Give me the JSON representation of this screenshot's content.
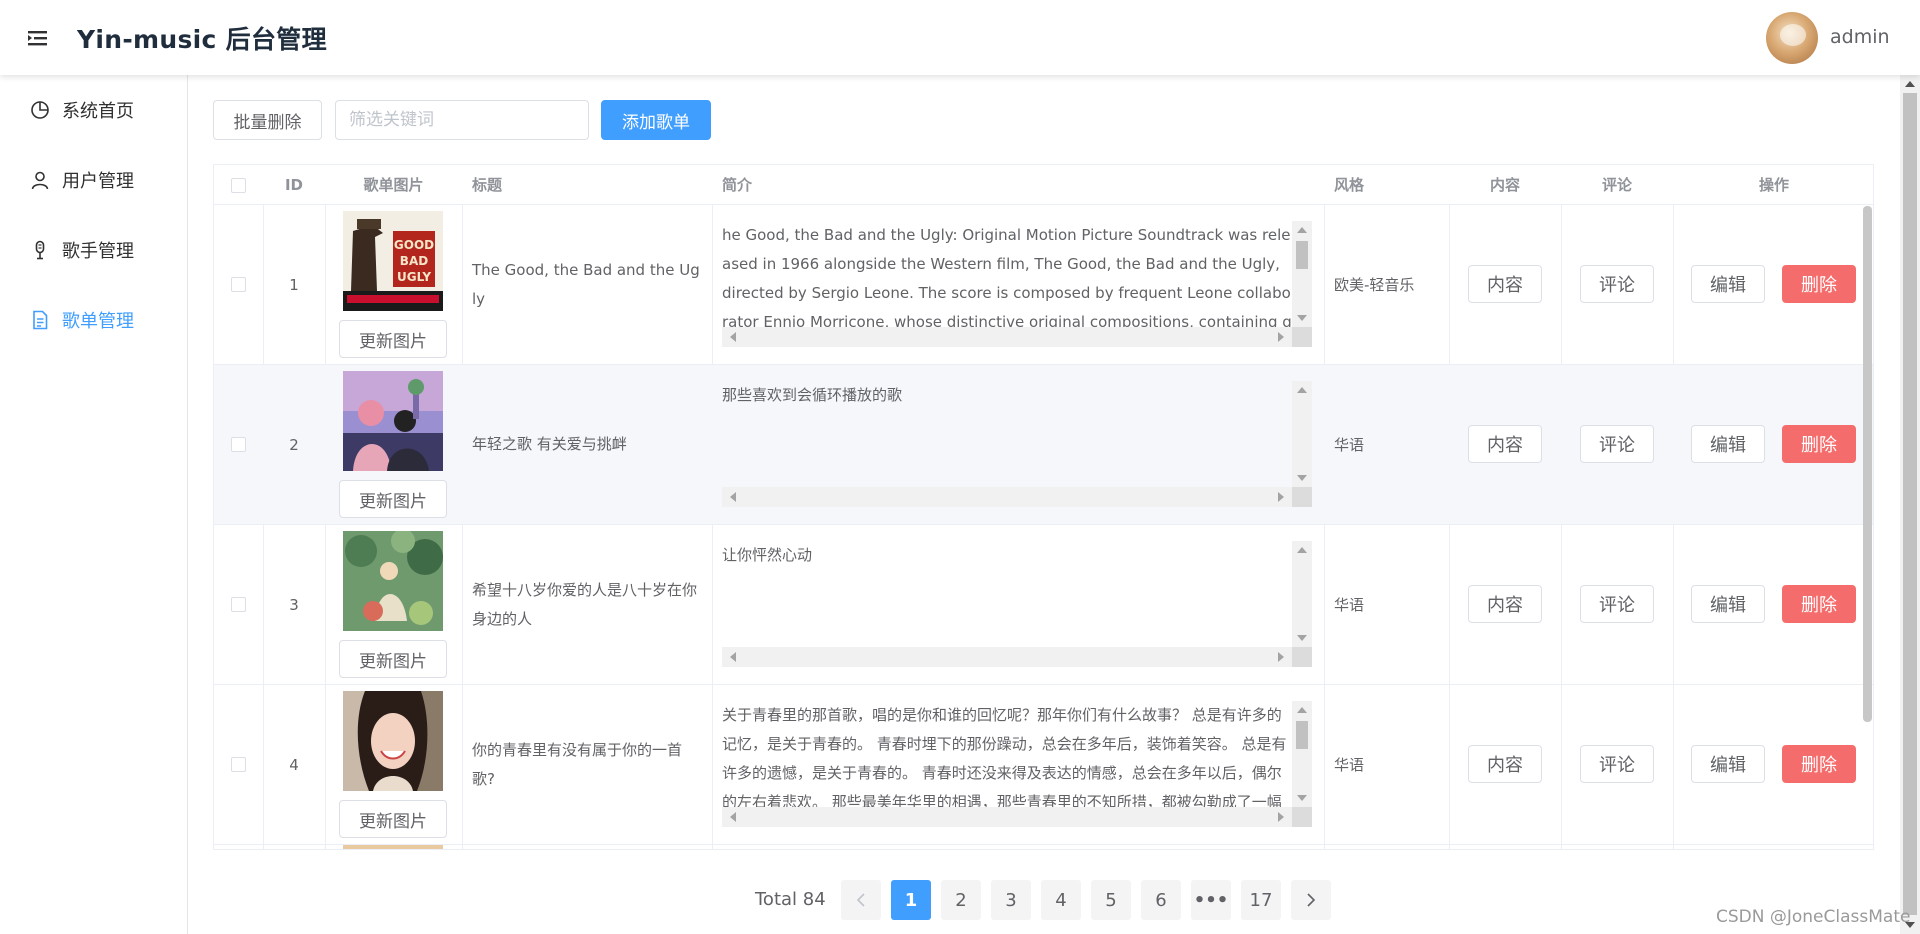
{
  "header": {
    "brand": "Yin-music 后台管理",
    "username": "admin",
    "menu_icon": "menu-fold-icon"
  },
  "sidebar": {
    "items": [
      {
        "label": "系统首页",
        "icon": "pie-chart-icon",
        "active": false
      },
      {
        "label": "用户管理",
        "icon": "user-icon",
        "active": false
      },
      {
        "label": "歌手管理",
        "icon": "microphone-icon",
        "active": false
      },
      {
        "label": "歌单管理",
        "icon": "document-icon",
        "active": true
      }
    ]
  },
  "toolbar": {
    "batch_delete_label": "批量删除",
    "search_placeholder": "筛选关键词",
    "search_value": "",
    "add_label": "添加歌单"
  },
  "table": {
    "headers": {
      "id": "ID",
      "image": "歌单图片",
      "title": "标题",
      "intro": "简介",
      "style": "风格",
      "content": "内容",
      "comment": "评论",
      "action": "操作"
    },
    "update_image_label": "更新图片",
    "content_label": "内容",
    "comment_label": "评论",
    "edit_label": "编辑",
    "delete_label": "删除",
    "rows": [
      {
        "id": "1",
        "title": "The Good, the Bad and the Ugly",
        "intro": "he Good, the Bad and the Ugly: Original Motion Picture Soundtrack was released in 1966 alongside the Western film, The Good, the Bad and the Ugly, directed by Sergio Leone. The score is composed by frequent Leone collaborator Ennio Morricone, whose distinctive original compositions, containing gunfire, whistling",
        "style": "欧美-轻音乐",
        "cover": "western-film-cover"
      },
      {
        "id": "2",
        "title": "年轻之歌 有关爱与挑衅",
        "intro": "那些喜欢到会循环播放的歌",
        "style": "华语",
        "cover": "couple-illustration-cover"
      },
      {
        "id": "3",
        "title": "希望十八岁你爱的人是八十岁在你身边的人",
        "intro": "让你怦然心动",
        "style": "华语",
        "cover": "garden-illustration-cover"
      },
      {
        "id": "4",
        "title": "你的青春里有没有属于你的一首歌?",
        "intro": "关于青春里的那首歌，唱的是你和谁的回忆呢？那年你们有什么故事？ 总是有许多的记忆，是关于青春的。 青春时埋下的那份躁动，总会在多年后，装饰着笑容。 总是有许多的遗憾，是关于青春的。 青春时还没来得及表达的情感，总会在多年以后，偶尔的左右着悲欢。 那些最美年华里的相遇，那些青春里的不知所措，都被勾勒成了一幅",
        "style": "华语",
        "cover": "smiling-girl-cover"
      }
    ]
  },
  "pagination": {
    "total_label": "Total 84",
    "pages": [
      "1",
      "2",
      "3",
      "4",
      "5",
      "6",
      "•••",
      "17"
    ],
    "current": "1"
  },
  "watermark": "CSDN @JoneClassMate",
  "colors": {
    "primary": "#409eff",
    "danger": "#f56c6c",
    "border": "#ebeef5"
  }
}
